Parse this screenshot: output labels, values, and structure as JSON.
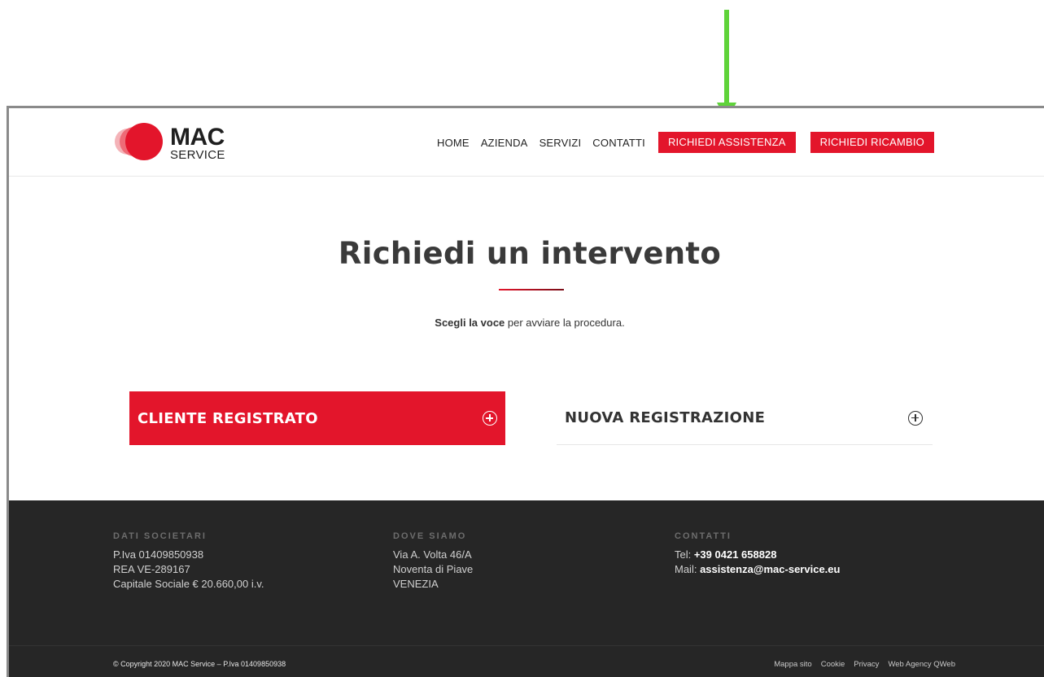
{
  "annotation": {
    "arrow_color": "#5fd33a"
  },
  "header": {
    "logo": {
      "word_top": "MAC",
      "word_bottom": "SERVICE"
    },
    "nav": {
      "home": "HOME",
      "azienda": "AZIENDA",
      "servizi": "SERVIZI",
      "contatti": "CONTATTI",
      "richiedi_assistenza": "RICHIEDI ASSISTENZA",
      "richiedi_ricambio": "RICHIEDI RICAMBIO"
    },
    "accent_color": "#e3152b"
  },
  "main": {
    "title": "Richiedi un intervento",
    "subtitle_bold": "Scegli la voce",
    "subtitle_rest": " per avviare la procedura.",
    "accordions": [
      {
        "label": "CLIENTE REGISTRATO",
        "active": true
      },
      {
        "label": "NUOVA REGISTRAZIONE",
        "active": false
      }
    ]
  },
  "footer": {
    "background": "#262626",
    "dati_societari": {
      "heading": "DATI SOCIETARI",
      "lines": [
        "P.Iva 01409850938",
        "REA VE-289167",
        "Capitale Sociale € 20.660,00 i.v."
      ]
    },
    "dove_siamo": {
      "heading": "DOVE SIAMO",
      "lines": [
        "Via A. Volta 46/A",
        "Noventa di Piave",
        "VENEZIA"
      ]
    },
    "contatti": {
      "heading": "CONTATTI",
      "tel_label": "Tel: ",
      "tel_value": "+39 0421 658828",
      "mail_label": "Mail: ",
      "mail_value": "assistenza@mac-service.eu"
    },
    "copyright": "© Copyright 2020 MAC Service – P.Iva 01409850938",
    "links": [
      "Mappa sito",
      "Cookie",
      "Privacy",
      "Web Agency QWeb"
    ]
  }
}
